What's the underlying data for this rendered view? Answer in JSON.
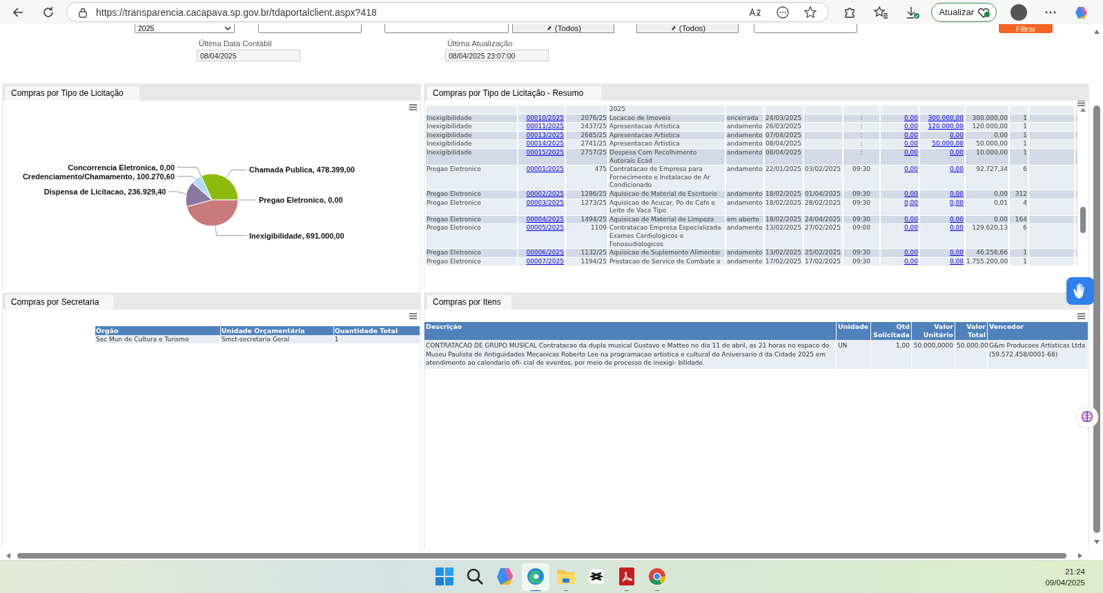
{
  "browser": {
    "url": "https://transparencia.cacapava.sp.gov.br/tdaportalclient.aspx?418",
    "update_button": "Atualizar"
  },
  "filters": {
    "year": "2025",
    "pin_buttons": [
      "(Todos)",
      "(Todos)"
    ],
    "submit_button": "Filtrar",
    "last_accounting_date": {
      "label": "Última Data Contábil",
      "value": "08/04/2025"
    },
    "last_update": {
      "label": "Última Atualização",
      "value": "08/04/2025 23:07:00"
    }
  },
  "pie_panel": {
    "tab": "Compras por Tipo de Licitação",
    "chart_data": {
      "type": "pie",
      "categories": [
        "Chamada Publica",
        "Pregao Eletronico",
        "Inexigibilidade",
        "Dispensa de Licitacao",
        "Credenciamento/Chamamento",
        "Concorrencia Eletronica"
      ],
      "values": [
        478399,
        0,
        691000,
        236929.4,
        100270.6,
        0
      ],
      "colors": [
        "#8cba0c",
        null,
        "#c97a7a",
        "#8a78a2",
        "#b5daf5",
        null
      ],
      "value_labels": [
        ", 478.399,00",
        ", 0,00",
        ", 691.000,00",
        ", 236.929,40",
        ", 100.270,60",
        ", 0,00"
      ]
    }
  },
  "summary_panel": {
    "tab": "Compras por Tipo de Licitação - Resumo",
    "rows": [
      {
        "description": "2025"
      },
      {
        "type": "Inexigibilidade",
        "number": "00010/2025",
        "process": "2076/25",
        "description": "Locacao de Imoveis",
        "status": "encerrada",
        "start_date": "24/03/2025",
        "time": ":",
        "value_1": "0,00",
        "value_2": "300.000,00",
        "value_3": "300.000,00",
        "quantity": "1"
      },
      {
        "type": "Inexigibilidade",
        "number": "00011/2025",
        "process": "2437/25",
        "description": "Apresentacao Artistica",
        "status": "andamento",
        "start_date": "26/03/2025",
        "time": ":",
        "value_1": "0,00",
        "value_2": "120.000,00",
        "value_3": "120.000,00",
        "quantity": "1"
      },
      {
        "type": "Inexigibilidade",
        "number": "00013/2025",
        "process": "2685/25",
        "description": "Apresentacao Artistica",
        "status": "andamento",
        "start_date": "07/04/2025",
        "time": ":",
        "value_1": "0,00",
        "value_2": "0,00",
        "value_3": "0,00",
        "quantity": "1"
      },
      {
        "type": "Inexigibilidade",
        "number": "00014/2025",
        "process": "2741/25",
        "description": "Apresentacao Artistica",
        "status": "andamento",
        "start_date": "08/04/2025",
        "time": ":",
        "value_1": "0,00",
        "value_2": "50.000,00",
        "value_3": "50.000,00",
        "quantity": "1"
      },
      {
        "type": "Inexigibilidade",
        "number": "00015/2025",
        "process": "2757/25",
        "description": "Despesa Com Recolhimento Autorais Ecad",
        "status": "andamento",
        "start_date": "08/04/2025",
        "time": ":",
        "value_1": "0,00",
        "value_2": "0,00",
        "value_3": "10.000,00",
        "quantity": "1"
      },
      {
        "type": "Pregao Eletronico",
        "number": "00001/2025",
        "process": "475",
        "description": "Contratacao de Empresa para Fornecimento e Instalacao de Ar Condicionado",
        "status": "andamento",
        "start_date": "22/01/2025",
        "end_date": "03/02/2025",
        "time": "09:30",
        "value_1": "0,00",
        "value_2": "0,00",
        "value_3": "92.727,34",
        "quantity": "6"
      },
      {
        "type": "Pregao Eletronico",
        "number": "00002/2025",
        "process": "1286/25",
        "description": "Aquisicao de Material de Escritorio",
        "status": "andamento",
        "start_date": "18/02/2025",
        "end_date": "01/04/2025",
        "time": "09:30",
        "value_1": "0,00",
        "value_2": "0,00",
        "value_3": "0,00",
        "quantity": "312"
      },
      {
        "type": "Pregao Eletronico",
        "number": "00003/2025",
        "process": "1273/25",
        "description": "Aquisicao de Acucar, Po de Cafe e Leite de Vaca Tipo",
        "status": "andamento",
        "start_date": "18/02/2025",
        "end_date": "28/02/2025",
        "time": "09:30",
        "value_1": "0,00",
        "value_2": "0,00",
        "value_3": "0,01",
        "quantity": "4"
      },
      {
        "type": "Pregao Eletronico",
        "number": "00004/2025",
        "process": "1494/25",
        "description": "Aquisicao de Material de Limpeza",
        "status": "em aberto",
        "start_date": "18/02/2025",
        "end_date": "24/04/2025",
        "time": "09:30",
        "value_1": "0,00",
        "value_2": "0,00",
        "value_3": "0,00",
        "quantity": "164"
      },
      {
        "type": "Pregao Eletronico",
        "number": "00005/2025",
        "process": "1109",
        "description": "Contratacao Empresa Especializada Exames Cardiologicos e Fonoaudiologicos",
        "status": "andamento",
        "start_date": "13/02/2025",
        "end_date": "27/02/2025",
        "time": "09:00",
        "value_1": "0,00",
        "value_2": "0,00",
        "value_3": "129.620,13",
        "quantity": "6"
      },
      {
        "type": "Pregao Eletronico",
        "number": "00006/2025",
        "process": "1132/25",
        "description": "Aquisicao de Suplemento Alimentar",
        "status": "andamento",
        "start_date": "13/02/2025",
        "end_date": "25/02/2025",
        "time": "09:30",
        "value_1": "0,00",
        "value_2": "0,00",
        "value_3": "46.256,66",
        "quantity": "1"
      },
      {
        "type": "Pregao Eletronico",
        "number": "00007/2025",
        "process": "1194/25",
        "description": "Prestacao de Servico de Combate a",
        "status": "andamento",
        "start_date": "17/02/2025",
        "end_date": "17/02/2025",
        "time": "09:30",
        "value_1": "0,00",
        "value_2": "0,00",
        "value_3": "1.755.200,00",
        "quantity": "1"
      }
    ]
  },
  "department_panel": {
    "tab": "Compras por Secretaria",
    "columns": [
      "Órgão",
      "Unidade Orçamentária",
      "Quantidade Total"
    ],
    "rows": [
      [
        "Sec Mun de Cultura e Turismo",
        "Smct-secretaria Geral",
        "1"
      ]
    ]
  },
  "items_panel": {
    "tab": "Compras por Itens",
    "columns": [
      "Descrição",
      "Unidade",
      "Qtd Solicitada",
      "Valor Unitário",
      "Valor Total",
      "Vencedor"
    ],
    "rows": [
      [
        "CONTRATACAO DE GRUPO MUSICAL Contratacao da dupla musical Gustavo e Matteo no dia 11 de abril, as 21 horas no espaco do Museu Paulista de Antiguidades Mecanicas Roberto Lee na programacao artistica e cultural do Aniversario d da Cidade 2025 em atendimento ao calendario ofi- cial de eventos, por meio de processo de inexigi- bilidade.",
        "UN",
        "1,00",
        "50.000,0000",
        "50.000,00",
        "G&m Producoes Artisticas Ltda (59.572.458/0001-68)"
      ]
    ]
  },
  "taskbar": {
    "apps": [
      {
        "kind": "start",
        "selected": false,
        "running": false
      },
      {
        "kind": "search",
        "selected": false,
        "running": false
      },
      {
        "kind": "copilot",
        "selected": false,
        "running": false
      },
      {
        "kind": "edge",
        "selected": true,
        "running": true
      },
      {
        "kind": "folder",
        "selected": false,
        "running": true
      },
      {
        "kind": "capcut",
        "selected": false,
        "running": false
      },
      {
        "kind": "pdf",
        "selected": false,
        "running": true
      },
      {
        "kind": "chrome",
        "selected": false,
        "running": true
      }
    ],
    "time": "21:24",
    "date": "09/04/2025"
  }
}
